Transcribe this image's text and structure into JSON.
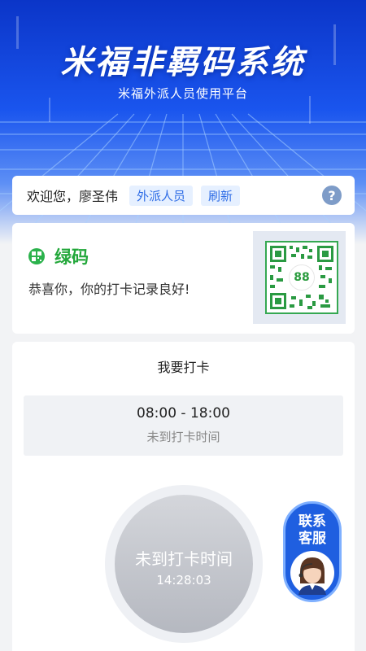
{
  "header": {
    "title": "米福非羁码系统",
    "subtitle": "米福外派人员使用平台"
  },
  "welcome": {
    "greeting": "欢迎您，廖圣伟",
    "role_chip": "外派人员",
    "refresh_label": "刷新",
    "help_icon": "question-icon",
    "help_glyph": "?"
  },
  "health_code": {
    "label": "绿码",
    "message": "恭喜你，你的打卡记录良好!",
    "qr_number": "88",
    "color": "#22a73a"
  },
  "checkin": {
    "heading": "我要打卡",
    "time_range": "08:00 - 18:00",
    "range_status": "未到打卡时间",
    "button_label": "未到打卡时间",
    "current_time": "14:28:03"
  },
  "service": {
    "label_line1": "联系",
    "label_line2": "客服"
  },
  "colors": {
    "brand_blue": "#1a55ee",
    "chip_bg": "#e6f0ff",
    "chip_text": "#2f6de6"
  }
}
